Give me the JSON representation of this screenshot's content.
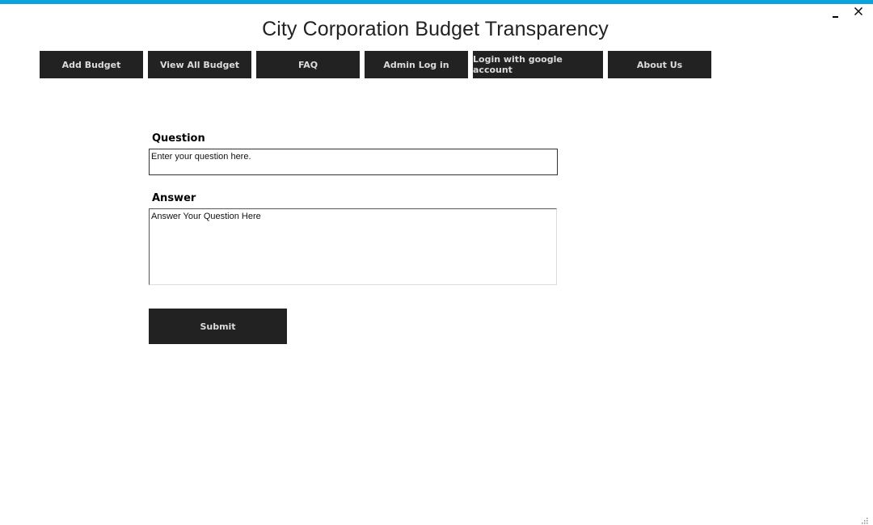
{
  "window": {
    "accent_color": "#0aa4dd",
    "controls": {
      "minimize_icon": "minimize-icon",
      "close_icon": "close-icon"
    }
  },
  "app": {
    "title": "City Corporation Budget Transparency"
  },
  "nav": {
    "button_color": "#222222",
    "items": [
      {
        "label": "Add Budget"
      },
      {
        "label": "View All Budget"
      },
      {
        "label": "FAQ"
      },
      {
        "label": "Admin Log in"
      },
      {
        "label": "Login with google account"
      },
      {
        "label": "About Us"
      }
    ]
  },
  "form": {
    "question": {
      "label": "Question",
      "value": "Enter your question here."
    },
    "answer": {
      "label": "Answer",
      "value": "Answer Your Question Here"
    },
    "submit_label": "Submit"
  }
}
